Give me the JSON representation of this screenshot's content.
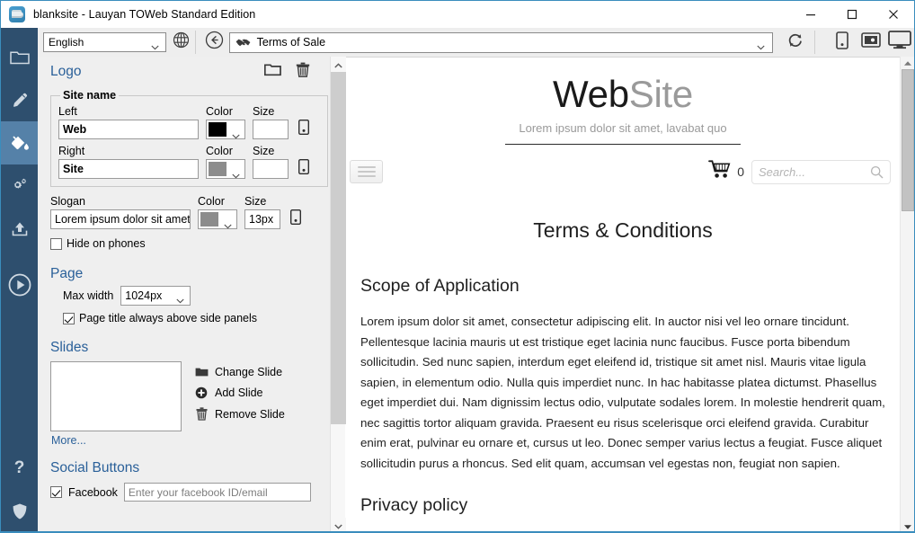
{
  "window": {
    "title": "blanksite - Lauyan TOWeb Standard Edition",
    "app_icon": "toweb-app-icon",
    "minimize_label": "Minimize",
    "maximize_label": "Maximize",
    "close_label": "Close"
  },
  "rail": {
    "items": [
      {
        "name": "sidebar-item-site",
        "icon": "folder-icon",
        "active": false
      },
      {
        "name": "sidebar-item-edit",
        "icon": "pencil-icon",
        "active": false
      },
      {
        "name": "sidebar-item-theme",
        "icon": "paint-bucket-icon",
        "active": true
      },
      {
        "name": "sidebar-item-settings",
        "icon": "gears-icon",
        "active": false
      },
      {
        "name": "sidebar-item-publish",
        "icon": "upload-icon",
        "active": false
      },
      {
        "name": "sidebar-item-preview",
        "icon": "play-circle-icon",
        "active": false
      }
    ],
    "bottom_items": [
      {
        "name": "sidebar-item-help",
        "icon": "question-mark-icon",
        "label": "?"
      },
      {
        "name": "sidebar-item-security",
        "icon": "shield-icon",
        "label": ""
      }
    ]
  },
  "toolbar": {
    "language_value": "English",
    "language_options": [
      "English"
    ],
    "globe_icon": "globe-icon",
    "back_icon": "back-arrow-icon",
    "page_value": "Terms of Sale",
    "page_icon": "handshake-icon",
    "refresh_icon": "refresh-icon",
    "devices": [
      {
        "name": "device-phone-button",
        "icon": "phone-icon"
      },
      {
        "name": "device-tablet-button",
        "icon": "tablet-icon"
      },
      {
        "name": "device-desktop-button",
        "icon": "desktop-icon"
      }
    ]
  },
  "panel": {
    "logo": {
      "title": "Logo",
      "browse_icon": "folder-open-icon",
      "delete_icon": "trash-icon",
      "site_name_group": "Site name",
      "left_label": "Left",
      "left_value": "Web",
      "left_color_label": "Color",
      "left_color_value": "#000000",
      "left_size_label": "Size",
      "left_size_value": "",
      "right_label": "Right",
      "right_value": "Site",
      "right_color_label": "Color",
      "right_color_value": "#8c8c8c",
      "right_size_label": "Size",
      "right_size_value": "",
      "slogan_label": "Slogan",
      "slogan_value": "Lorem ipsum dolor sit amet",
      "slogan_color_label": "Color",
      "slogan_color_value": "#8c8c8c",
      "slogan_size_label": "Size",
      "slogan_size_value": "13px",
      "hide_on_phones_label": "Hide on phones",
      "hide_on_phones_checked": false,
      "phone_toggle_icon": "phone-icon"
    },
    "page": {
      "title": "Page",
      "max_width_label": "Max width",
      "max_width_value": "1024px",
      "max_width_options": [
        "1024px"
      ],
      "page_title_above_label": "Page title always above side panels",
      "page_title_above_checked": true
    },
    "slides": {
      "title": "Slides",
      "change_label": "Change Slide",
      "change_icon": "folder-open-icon",
      "add_label": "Add Slide",
      "add_icon": "plus-circle-icon",
      "remove_label": "Remove Slide",
      "remove_icon": "trash-icon",
      "more_label": "More..."
    },
    "social": {
      "title": "Social Buttons",
      "facebook_label": "Facebook",
      "facebook_checked": true,
      "facebook_placeholder": "Enter your facebook ID/email",
      "facebook_value": ""
    },
    "accent_color": "#2a6099"
  },
  "preview": {
    "logo_left": "Web",
    "logo_right": "Site",
    "slogan": "Lorem ipsum dolor sit amet, lavabat quo",
    "menu_icon": "hamburger-menu-icon",
    "cart_icon": "shopping-cart-icon",
    "cart_count": "0",
    "search_placeholder": "Search...",
    "search_icon": "search-icon",
    "page_title": "Terms & Conditions",
    "sections": [
      {
        "heading": "Scope of Application",
        "body": "Lorem ipsum dolor sit amet, consectetur adipiscing elit. In auctor nisi vel leo ornare tincidunt. Pellentesque lacinia mauris ut est tristique eget lacinia nunc faucibus. Fusce porta bibendum sollicitudin. Sed nunc sapien, interdum eget eleifend id, tristique sit amet nisl. Mauris vitae ligula sapien, in elementum odio. Nulla quis imperdiet nunc. In hac habitasse platea dictumst. Phasellus eget imperdiet dui. Nam dignissim lectus odio, vulputate sodales lorem. In molestie hendrerit quam, nec sagittis tortor aliquam gravida. Praesent eu risus scelerisque orci eleifend gravida. Curabitur enim erat, pulvinar eu ornare et, cursus ut leo. Donec semper varius lectus a feugiat. Fusce aliquet sollicitudin purus a rhoncus. Sed elit quam, accumsan vel egestas non, feugiat non sapien."
      },
      {
        "heading": "Privacy policy",
        "body": ""
      }
    ]
  },
  "scrollbars": {
    "left_up_icon": "chevron-up-icon",
    "left_down_icon": "chevron-down-icon",
    "right_up_icon": "triangle-up-icon",
    "right_down_icon": "triangle-down-icon"
  }
}
